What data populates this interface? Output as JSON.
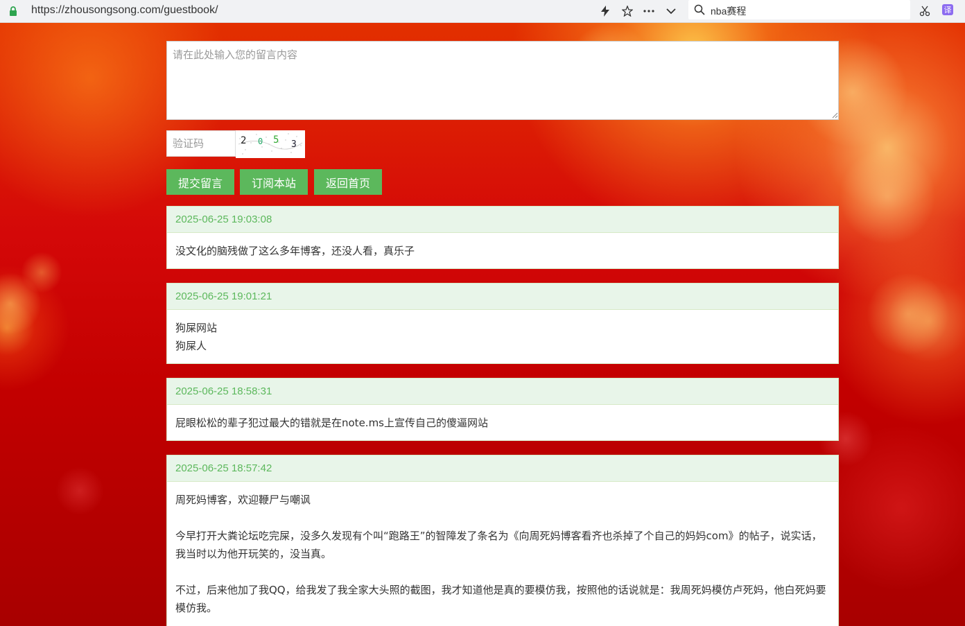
{
  "browser": {
    "url": "https://zhousongsong.com/guestbook/",
    "search_text": "nba赛程",
    "translate_label": "译"
  },
  "form": {
    "message_placeholder": "请在此处输入您的留言内容",
    "captcha_placeholder": "验证码",
    "captcha_code": "2053",
    "buttons": {
      "submit": "提交留言",
      "subscribe": "订阅本站",
      "home": "返回首页"
    }
  },
  "comments": [
    {
      "time": "2025-06-25 19:03:08",
      "lines": [
        "没文化的脑残做了这么多年博客，还没人看，真乐子"
      ]
    },
    {
      "time": "2025-06-25 19:01:21",
      "lines": [
        "狗屎网站",
        "狗屎人"
      ]
    },
    {
      "time": "2025-06-25 18:58:31",
      "lines": [
        "屁眼松松的辈子犯过最大的错就是在note.ms上宣传自己的傻逼网站"
      ]
    },
    {
      "time": "2025-06-25 18:57:42",
      "paragraphs": [
        "周死妈博客，欢迎鞭尸与嘲讽",
        "今早打开大粪论坛吃完屎，没多久发现有个叫“跑路王”的智障发了条名为《向周死妈博客看齐也杀掉了个自己的妈妈com》的帖子，说实话，我当时以为他开玩笑的，没当真。",
        "不过，后来他加了我QQ，给我发了我全家大头照的截图，我才知道他是真的要模仿我，按照他的话说就是：我周死妈模仿卢死妈，他白死妈要模仿我。"
      ]
    }
  ],
  "colors": {
    "button": "#5cb85c",
    "card_header_bg": "#e8f5e9",
    "card_header_text": "#5cb85c",
    "card_border": "#d6e9c6"
  }
}
